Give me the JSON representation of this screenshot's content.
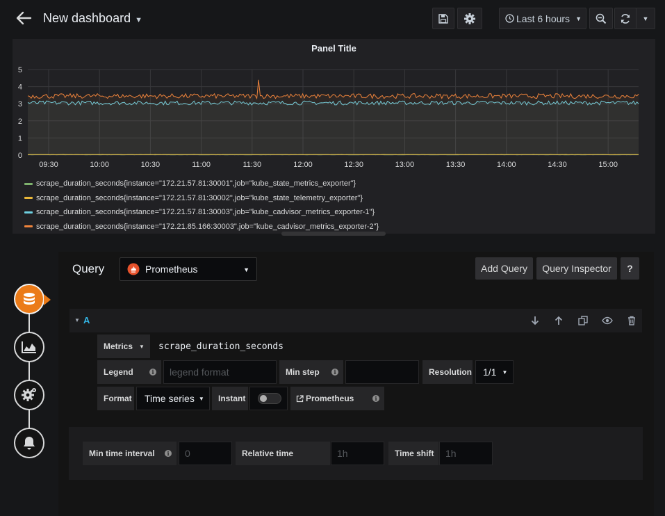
{
  "header": {
    "title": "New dashboard",
    "time_range_label": "Last 6 hours"
  },
  "panel": {
    "title": "Panel Title"
  },
  "chart_data": {
    "type": "line",
    "title": "Panel Title",
    "x_ticks": [
      "09:30",
      "10:00",
      "10:30",
      "11:00",
      "11:30",
      "12:00",
      "12:30",
      "13:00",
      "13:30",
      "14:00",
      "14:30",
      "15:00"
    ],
    "y_ticks": [
      "0",
      "1",
      "2",
      "3",
      "4",
      "5"
    ],
    "ylim": [
      0,
      5
    ],
    "grid": true,
    "legend_position": "bottom",
    "series": [
      {
        "name": "scrape_duration_seconds{instance=\"172.21.57.81:30001\",job=\"kube_state_metrics_exporter\"}",
        "color": "#7eb26d",
        "mean": 0.02,
        "noise": 0.005
      },
      {
        "name": "scrape_duration_seconds{instance=\"172.21.57.81:30002\",job=\"kube_state_telemetry_exporter\"}",
        "color": "#eab839",
        "mean": 0.03,
        "noise": 0.005
      },
      {
        "name": "scrape_duration_seconds{instance=\"172.21.57.81:30003\",job=\"kube_cadvisor_metrics_exporter-1\"}",
        "color": "#6ed0e0",
        "mean": 3.05,
        "noise": 0.12
      },
      {
        "name": "scrape_duration_seconds{instance=\"172.21.85.166:30003\",job=\"kube_cadvisor_metrics_exporter-2\"}",
        "color": "#ef843c",
        "mean": 3.45,
        "noise": 0.14
      }
    ]
  },
  "query": {
    "label": "Query",
    "datasource": "Prometheus",
    "add_query_label": "Add Query",
    "inspector_label": "Query Inspector",
    "help_label": "?",
    "ref_id": "A",
    "metrics_label": "Metrics",
    "metrics_value": "scrape_duration_seconds",
    "legend_label": "Legend",
    "legend_placeholder": "legend format",
    "min_step_label": "Min step",
    "resolution_label": "Resolution",
    "resolution_value": "1/1",
    "format_label": "Format",
    "format_value": "Time series",
    "instant_label": "Instant",
    "prometheus_link": "Prometheus"
  },
  "options": {
    "min_interval_label": "Min time interval",
    "min_interval_placeholder": "0",
    "relative_time_label": "Relative time",
    "relative_time_placeholder": "1h",
    "time_shift_label": "Time shift",
    "time_shift_placeholder": "1h"
  }
}
